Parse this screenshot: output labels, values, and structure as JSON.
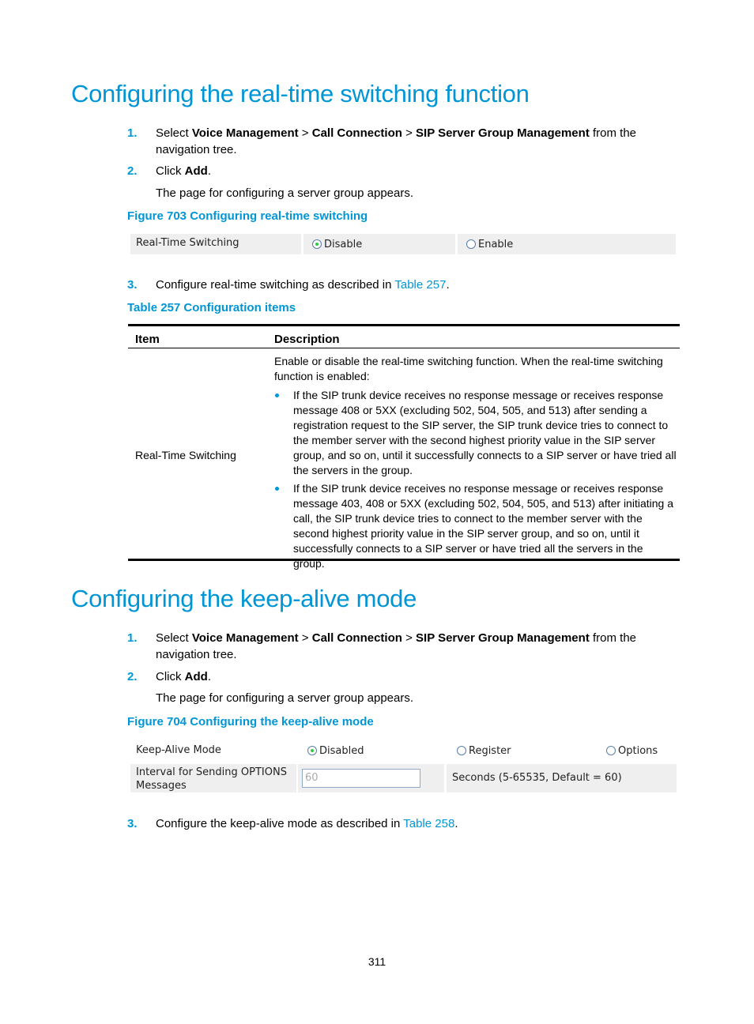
{
  "section1": {
    "title": "Configuring the real-time switching function",
    "steps": [
      {
        "num": "1.",
        "pre": "Select ",
        "b1": "Voice Management",
        "s1": " > ",
        "b2": "Call Connection",
        "s2": " > ",
        "b3": "SIP Server Group Management",
        "post": " from the navigation tree."
      },
      {
        "num": "2.",
        "pre": "Click ",
        "b1": "Add",
        "post": "."
      }
    ],
    "step2_note": "The page for configuring a server group appears.",
    "figure_caption": "Figure 703 Configuring real-time switching",
    "figure": {
      "label": "Real-Time Switching",
      "options": [
        {
          "label": "Disable",
          "selected": true
        },
        {
          "label": "Enable",
          "selected": false
        }
      ]
    },
    "step3": {
      "num": "3.",
      "pre": "Configure real-time switching as described in ",
      "link": "Table 257",
      "post": "."
    },
    "table_caption": "Table 257 Configuration items",
    "table": {
      "headers": [
        "Item",
        "Description"
      ],
      "rows": [
        {
          "item": "Real-Time Switching",
          "intro": "Enable or disable the real-time switching function. When the real-time switching function is enabled:",
          "bullets": [
            "If the SIP trunk device receives no response message or receives response message 408 or 5XX (excluding 502, 504, 505, and 513) after sending a registration request to the SIP server, the SIP trunk device tries to connect to the member server with the second highest priority value in the SIP server group, and so on, until it successfully connects to a SIP server or have tried all the servers in the group.",
            "If the SIP trunk device receives no response message or receives response message 403, 408 or 5XX (excluding 502, 504, 505, and 513) after initiating a call, the SIP trunk device tries to connect to the member server with the second highest priority value in the SIP server group, and so on, until it successfully connects to a SIP server or have tried all the servers in the group."
          ]
        }
      ]
    }
  },
  "section2": {
    "title": "Configuring the keep-alive mode",
    "steps": [
      {
        "num": "1.",
        "pre": "Select ",
        "b1": "Voice Management",
        "s1": " > ",
        "b2": "Call Connection",
        "s2": " > ",
        "b3": "SIP Server Group Management",
        "post": " from the navigation tree."
      },
      {
        "num": "2.",
        "pre": "Click ",
        "b1": "Add",
        "post": "."
      }
    ],
    "step2_note": "The page for configuring a server group appears.",
    "figure_caption": "Figure 704 Configuring the keep-alive mode",
    "figure": {
      "mode_label": "Keep-Alive Mode",
      "mode_options": [
        {
          "label": "Disabled",
          "selected": true
        },
        {
          "label": "Register",
          "selected": false
        },
        {
          "label": "Options",
          "selected": false
        }
      ],
      "interval_label": "Interval for Sending OPTIONS Messages",
      "interval_value": "60",
      "interval_hint": "Seconds (5-65535, Default = 60)"
    },
    "step3": {
      "num": "3.",
      "pre": "Configure the keep-alive mode as described in ",
      "link": "Table 258",
      "post": "."
    }
  },
  "page_number": "311",
  "colors": {
    "accent": "#0096d6",
    "form_bg": "#efefef",
    "radio_dot": "#2ecc40"
  }
}
